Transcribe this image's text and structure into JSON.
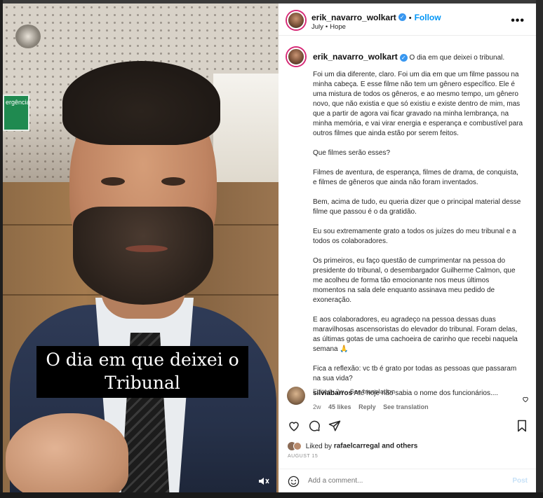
{
  "video": {
    "caption_line1": "O dia em que deixei o",
    "caption_line2": "Tribunal",
    "exit_sign_text": "ergência",
    "mute_icon": "speaker-muted-icon"
  },
  "header": {
    "username": "erik_navarro_wolkart",
    "follow_label": "Follow",
    "subtitle_left": "July",
    "subtitle_right": "Hope",
    "more_icon": "more-horizontal-icon"
  },
  "post": {
    "username": "erik_navarro_wolkart",
    "title": "O dia em que deixei o tribunal.",
    "paragraphs": [
      "Foi um dia diferente, claro. Foi um dia em que um filme passou na minha cabeça. E esse filme não tem um gênero específico. Ele é uma mistura de todos os gêneros, e ao mesmo tempo, um gênero novo, que não existia e que só existiu e existe dentro de mim, mas que a partir de agora vai ficar gravado na minha lembrança, na minha memória, e vai virar energia e esperança e combustível para outros filmes que ainda estão por serem feitos.",
      "Que filmes serão esses?",
      "Filmes de aventura, de esperança, filmes de drama, de conquista, e filmes de gêneros que ainda não foram inventados.",
      "Bem, acima de tudo, eu queria dizer que o principal material desse filme que passou é o da gratidão.",
      "Eu sou extremamente grato a todos os juízes do meu tribunal e a todos os colaboradores.",
      "Os primeiros, eu faço questão de cumprimentar na pessoa do presidente do tribunal, o desembargador Guilherme Calmon, que me acolheu de forma tão emocionante nos meus últimos momentos na sala dele enquanto assinava meu pedido de exoneração.",
      "E aos colaboradores, eu agradeço na pessoa dessas duas maravilhosas ascensoristas do elevador do tribunal. Foram delas, as últimas gotas de uma cachoeira de carinho que recebi naquela semana 🙏",
      "Fica a reflexão: vc tb é grato por todas as pessoas que passaram na sua vida?"
    ],
    "edited": "Edited",
    "edited_time": "2w",
    "see_translation": "See translation"
  },
  "comment": {
    "username": "silviabarros",
    "text": "Até hoje não sabia o nome dos funcionários....",
    "time": "2w",
    "likes": "45 likes",
    "reply": "Reply",
    "see_translation": "See translation"
  },
  "footer": {
    "liked_by_prefix": "Liked by",
    "liked_by_user": "rafaelcarregal",
    "and_others": "and others",
    "date": "AUGUST 15",
    "comment_placeholder": "Add a comment...",
    "post_label": "Post"
  },
  "colors": {
    "accent": "#0095f6",
    "verified": "#3897f0",
    "story_ring": "#d62976"
  }
}
